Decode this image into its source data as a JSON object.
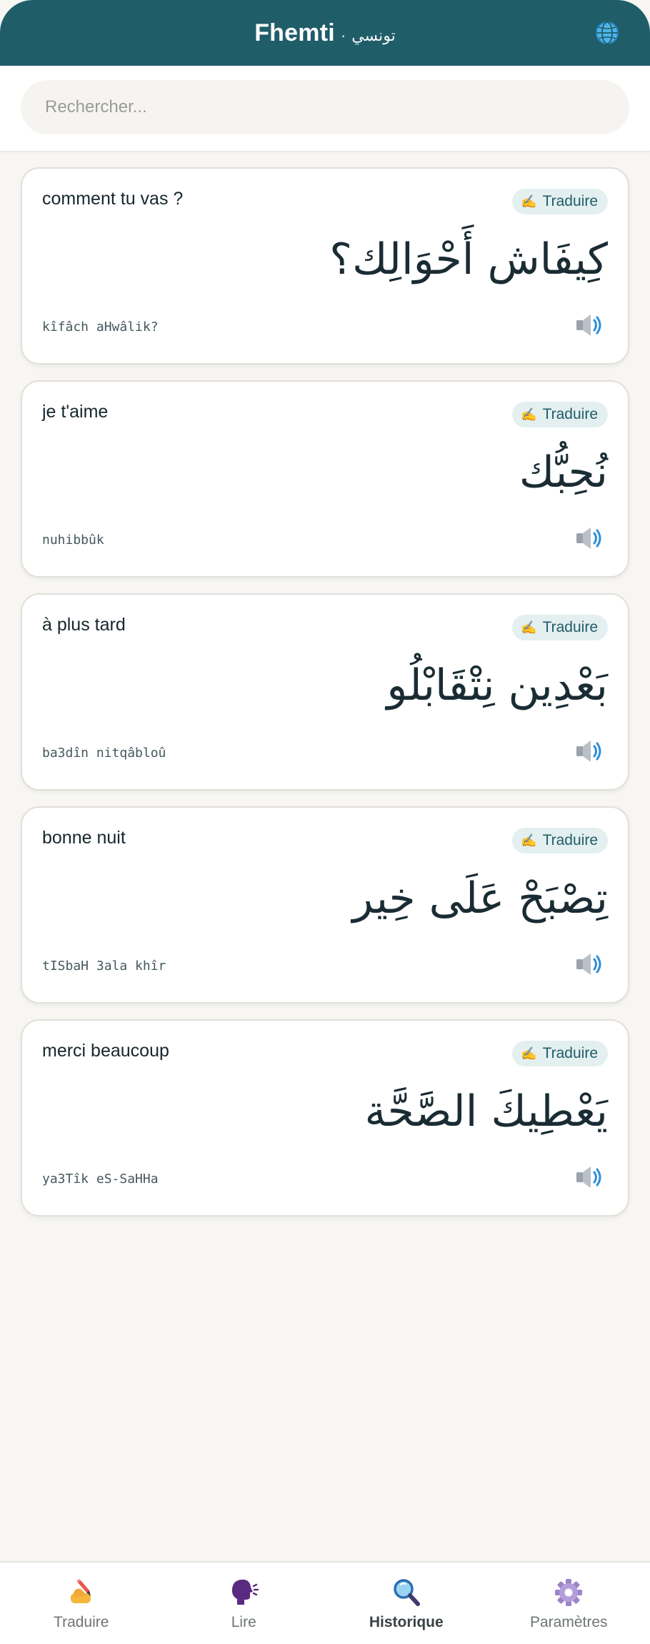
{
  "header": {
    "app_name": "Fhemti",
    "separator": "·",
    "dialect": "تونسي",
    "globe_icon": "globe-icon"
  },
  "search": {
    "placeholder": "Rechercher...",
    "value": ""
  },
  "history": [
    {
      "french": "comment tu vas ?",
      "badge_label": "Traduire",
      "badge_icon": "writing-hand-icon",
      "arabic": "كِيفَاش أَحْوَالِك؟",
      "transliteration": "kîfâch aHwâlik?",
      "speaker_icon": "speaker-icon"
    },
    {
      "french": "je t'aime",
      "badge_label": "Traduire",
      "badge_icon": "writing-hand-icon",
      "arabic": "نُحِبُّك",
      "transliteration": "nuhibbûk",
      "speaker_icon": "speaker-icon"
    },
    {
      "french": "à plus tard",
      "badge_label": "Traduire",
      "badge_icon": "writing-hand-icon",
      "arabic": "بَعْدِين نِتْقَابْلُو",
      "transliteration": "ba3dîn nitqâbloû",
      "speaker_icon": "speaker-icon"
    },
    {
      "french": "bonne nuit",
      "badge_label": "Traduire",
      "badge_icon": "writing-hand-icon",
      "arabic": "تِصْبَحْ عَلَى خِير",
      "transliteration": "tISbaH 3ala khîr",
      "speaker_icon": "speaker-icon"
    },
    {
      "french": "merci beaucoup",
      "badge_label": "Traduire",
      "badge_icon": "writing-hand-icon",
      "arabic": "يَعْطِيكَ الصَّحَّة",
      "transliteration": "ya3Tîk eS-SaHHa",
      "speaker_icon": "speaker-icon"
    }
  ],
  "nav": {
    "active": "Historique",
    "items": [
      {
        "label": "Traduire",
        "icon": "writing-hand-icon"
      },
      {
        "label": "Lire",
        "icon": "speaking-head-icon"
      },
      {
        "label": "Historique",
        "icon": "magnifier-icon"
      },
      {
        "label": "Paramètres",
        "icon": "gear-icon"
      }
    ]
  },
  "colors": {
    "brand": "#1f5d69",
    "badge_bg": "#e4eff0",
    "page_bg": "#f7f6f3"
  }
}
